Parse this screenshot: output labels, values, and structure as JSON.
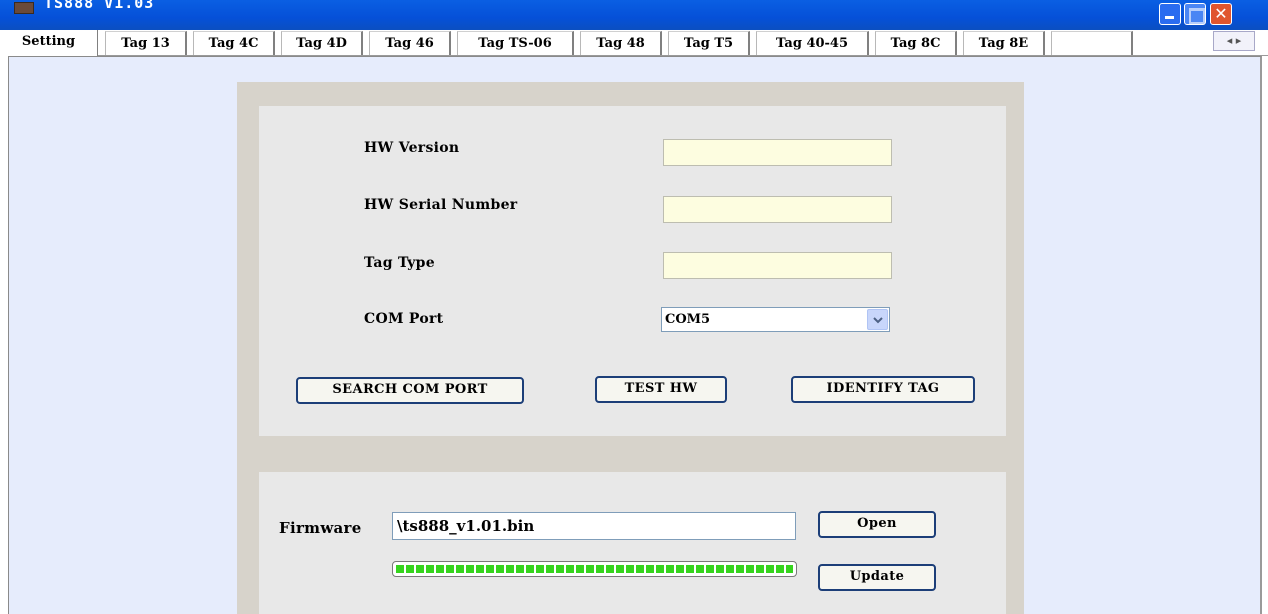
{
  "window": {
    "title": "TS888 V1.03"
  },
  "tabs": [
    {
      "label": "Setting",
      "active": true
    },
    {
      "label": "Tag 13"
    },
    {
      "label": "Tag 4C"
    },
    {
      "label": "Tag 4D"
    },
    {
      "label": "Tag 46"
    },
    {
      "label": "Tag TS-06"
    },
    {
      "label": "Tag 48"
    },
    {
      "label": "Tag T5"
    },
    {
      "label": "Tag 40-45"
    },
    {
      "label": "Tag 8C"
    },
    {
      "label": "Tag 8E"
    },
    {
      "label": ""
    }
  ],
  "tab_scroll_icons": [
    "scroll-left-icon",
    "scroll-right-icon"
  ],
  "hardware": {
    "hw_version_label": "HW Version",
    "hw_version_value": "",
    "hw_serial_label": "HW Serial Number",
    "hw_serial_value": "",
    "tag_type_label": "Tag Type",
    "tag_type_value": "",
    "com_port_label": "COM Port",
    "com_port_value": "COM5"
  },
  "buttons": {
    "search_com_port": "SEARCH COM PORT",
    "test_hw": "TEST HW",
    "identify_tag": "IDENTIFY TAG"
  },
  "firmware": {
    "label": "Firmware",
    "path": "\\ts888_v1.01.bin",
    "open_label": "Open",
    "update_label": "Update",
    "progress": 1.0
  },
  "colors": {
    "titlebar": "#0a5fe3",
    "page_background": "#e6ecfc",
    "panel": "#e8e8e8",
    "field_background": "#fdfde0",
    "progress": "#36d41e",
    "close_button": "#e0552e"
  }
}
